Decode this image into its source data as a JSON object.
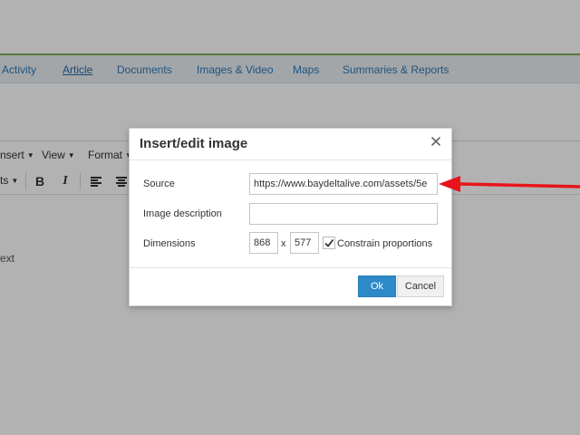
{
  "nav": {
    "items": [
      {
        "label": "Activity",
        "active": false
      },
      {
        "label": "Article",
        "active": true
      },
      {
        "label": "Documents",
        "active": false
      },
      {
        "label": "Images & Video",
        "active": false
      },
      {
        "label": "Maps",
        "active": false
      },
      {
        "label": "Summaries & Reports",
        "active": false
      }
    ]
  },
  "editor": {
    "menubar": {
      "insert": "nsert",
      "view": "View",
      "format": "Format"
    },
    "toolbar": {
      "formats": "ts",
      "bold": "B",
      "italic": "I"
    },
    "body_text": "ext"
  },
  "dialog": {
    "title": "Insert/edit image",
    "source_label": "Source",
    "source_value": "https://www.baydeltalive.com/assets/5e",
    "description_label": "Image description",
    "description_value": "",
    "dimensions_label": "Dimensions",
    "width": "868",
    "height": "577",
    "dim_separator": "x",
    "constrain_label": "Constrain proportions",
    "constrain_checked": true,
    "ok_label": "Ok",
    "cancel_label": "Cancel"
  },
  "icons": {
    "close": "close-icon",
    "check": "check-icon",
    "align_left": "align-left-icon",
    "align_center": "align-center-icon",
    "caret": "caret-down-icon",
    "annotation": "red-arrow-annotation"
  },
  "colors": {
    "accent": "#2d8ac7",
    "nav_link": "#2f78b5",
    "top_rule": "#7fae5a",
    "annotation_arrow": "#e8141b"
  }
}
